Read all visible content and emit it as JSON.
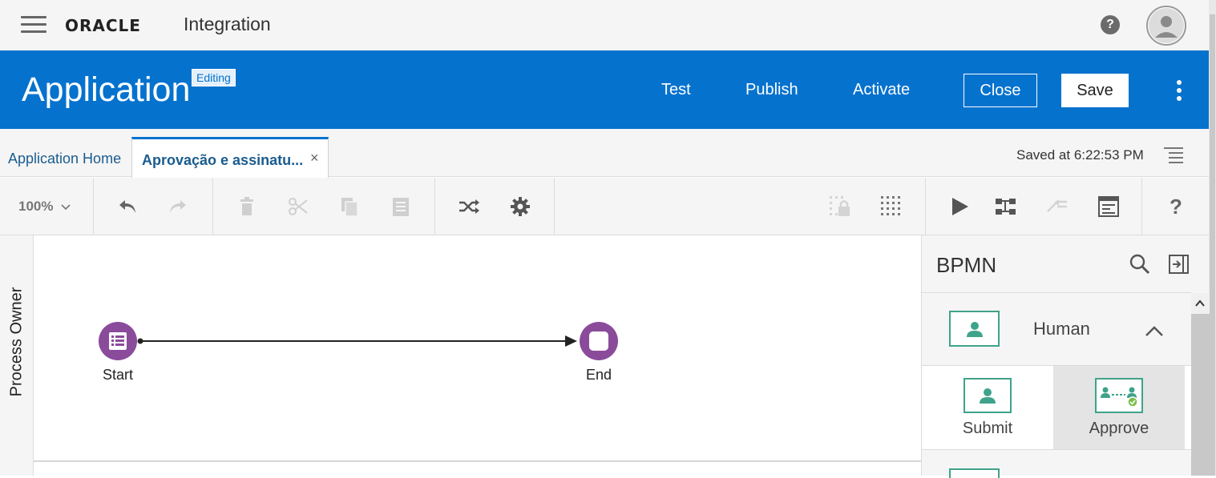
{
  "topbar": {
    "brand": "ORACLE",
    "product": "Integration",
    "help_icon": "?"
  },
  "app_header": {
    "title": "Application",
    "status_badge": "Editing",
    "links": {
      "test": "Test",
      "publish": "Publish",
      "activate": "Activate"
    },
    "close_label": "Close",
    "save_label": "Save"
  },
  "tabs": {
    "home": "Application Home",
    "active": "Aprovação e assinatu...",
    "close_icon": "×",
    "saved_status": "Saved at 6:22:53 PM"
  },
  "toolbar": {
    "zoom": "100%",
    "help": "?"
  },
  "canvas": {
    "swimlane_label": "Process Owner",
    "start_label": "Start",
    "end_label": "End",
    "node_color": "#8b4b9b"
  },
  "palette": {
    "title": "BPMN",
    "category": "Human",
    "items": [
      {
        "label": "Submit",
        "icon": "person-icon"
      },
      {
        "label": "Approve",
        "icon": "approve-icon"
      }
    ],
    "accent_color": "#3ea38a"
  },
  "colors": {
    "brand_blue": "#0572ce"
  }
}
